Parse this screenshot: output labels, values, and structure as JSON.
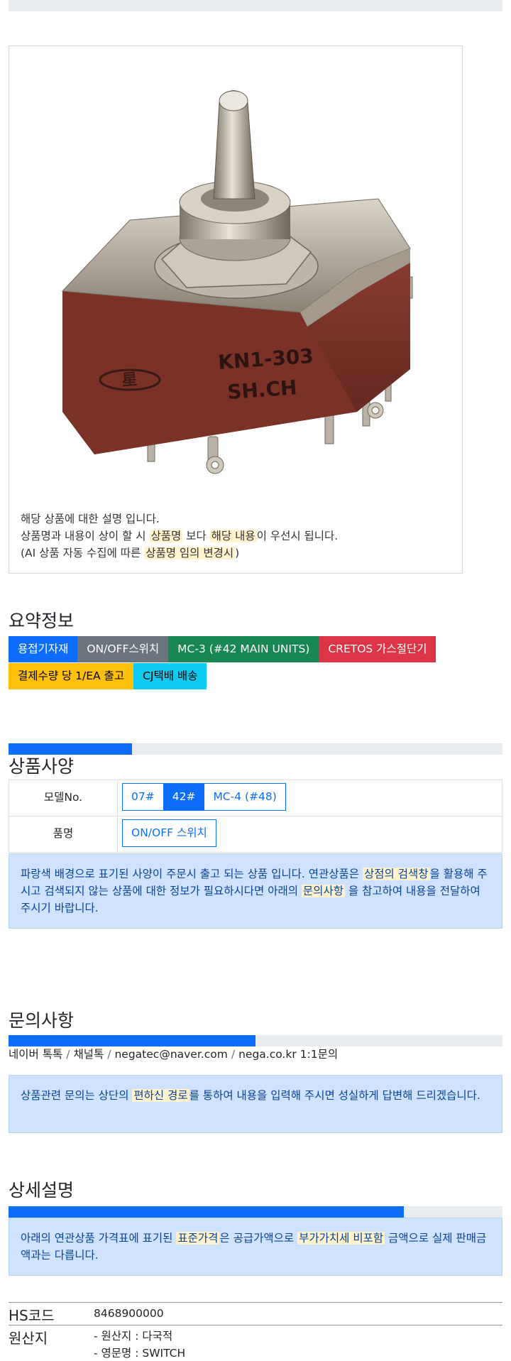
{
  "product": {
    "image_label": "KN1-303 SH.CH",
    "image_line1": "KN1-303",
    "image_line2": "SH.CH",
    "desc_line1": "해당 상품에 대한 설명 입니다.",
    "desc_line2_a": "상품명과 내용이 상이 할 시 ",
    "desc_line2_hl1": "상품명",
    "desc_line2_b": " 보다 ",
    "desc_line2_hl2": "해당 내용",
    "desc_line2_c": "이 우선시 됩니다.",
    "desc_line3_a": "(AI 상품 자동 수집에 따른 ",
    "desc_line3_hl": "상품명 임의 변경시",
    "desc_line3_b": ")"
  },
  "summary": {
    "title": "요약정보",
    "badges_row1": [
      "용접기자재",
      "ON/OFF스위치",
      "MC-3 (#42 MAIN UNITS)",
      "CRETOS 가스절단기"
    ],
    "badges_row2": [
      "결제수량 당 1/EA 출고",
      "CJ택배 배송"
    ]
  },
  "spec": {
    "title": "상품사양",
    "progress": 0.25,
    "model_label": "모델No.",
    "model_options": [
      "07#",
      "42#",
      "MC-4 (#48)"
    ],
    "model_selected": "42#",
    "name_label": "품명",
    "name_options": [
      "ON/OFF 스위치"
    ],
    "alert_a": "파랑색 배경으로 표기된 사양이 주문시 출고 되는 상품 입니다. 연관상품은 ",
    "alert_hl1": "상점의 검색창",
    "alert_b": "을 활용해 주시고 검색되지 않는 상품에 대한 정보가 필요하시다면 아래의 ",
    "alert_hl2": "문의사항",
    "alert_c": " 을 참고하여 내용을 전달하여 주시기 바랍니다."
  },
  "inquiry": {
    "title": "문의사항",
    "progress": 0.5,
    "links": [
      "네이버 톡톡",
      "채널톡",
      "negatec@naver.com",
      "nega.co.kr 1:1문의"
    ],
    "separator": "/",
    "alert_a": "상품관련 문의는 상단의 ",
    "alert_hl": "편하신 경로",
    "alert_b": "를 통하여 내용을 입력해 주시면 성실하게 답변해 드리겠습니다."
  },
  "detail": {
    "title": "상세설명",
    "progress": 0.8,
    "alert_a": "아래의 연관상품 가격표에 표기된 ",
    "alert_hl1": "표준가격",
    "alert_b": "은 공급가액으로 ",
    "alert_hl2": "부가가치세 비포함",
    "alert_c": " 금액으로 실제 판매금액과는 다릅니다."
  },
  "info": {
    "hs_label": "HS코드",
    "hs_value": "8468900000",
    "origin_label": "원산지",
    "origin_line1": "- 원산지 : 다국적",
    "origin_line2": "- 영문명 : SWITCH"
  },
  "colors": {
    "primary": "#0d6efd",
    "secondary": "#6c757d",
    "success": "#198754",
    "danger": "#dc3545",
    "warning": "#ffc107",
    "info": "#0dcaf0",
    "alert_bg": "#cfe2ff",
    "highlight": "#fff3cd"
  }
}
